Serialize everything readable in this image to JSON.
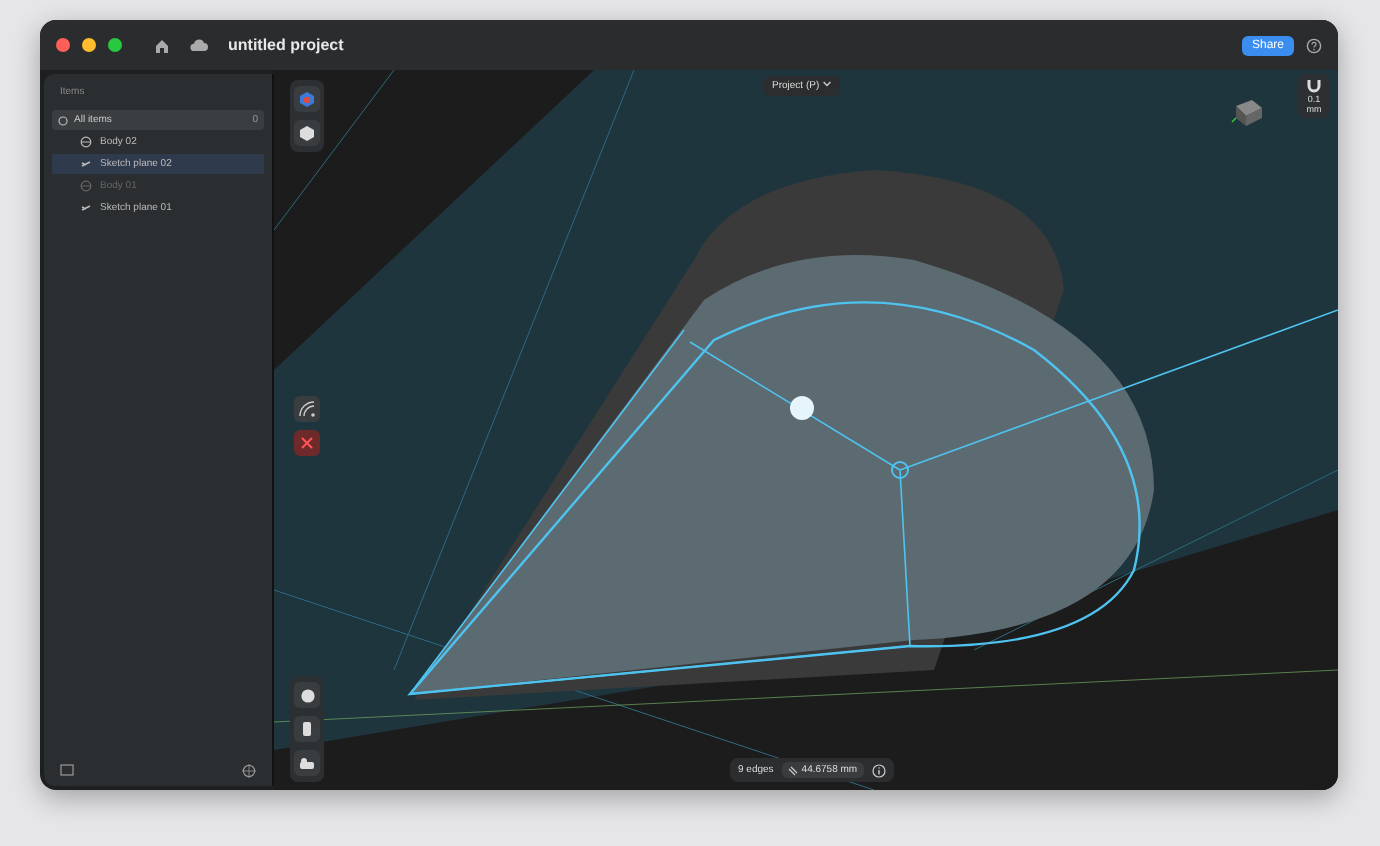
{
  "window": {
    "title": "untitled project"
  },
  "toolbar": {
    "share": "Share"
  },
  "sidebar": {
    "heading": "Items",
    "all_items": {
      "label": "All items",
      "count": "0"
    },
    "items": [
      {
        "label": "Body 02",
        "kind": "body",
        "selected": false,
        "dimmed": false
      },
      {
        "label": "Sketch plane 02",
        "kind": "sketch",
        "selected": true,
        "dimmed": false
      },
      {
        "label": "Body 01",
        "kind": "body",
        "selected": false,
        "dimmed": true
      },
      {
        "label": "Sketch plane 01",
        "kind": "sketch",
        "selected": false,
        "dimmed": false
      }
    ]
  },
  "canvas": {
    "view_menu": "Project (P)",
    "snap": "0.1 mm"
  },
  "status_bar": {
    "selection": "9 edges",
    "measure": "44.6758 mm"
  }
}
